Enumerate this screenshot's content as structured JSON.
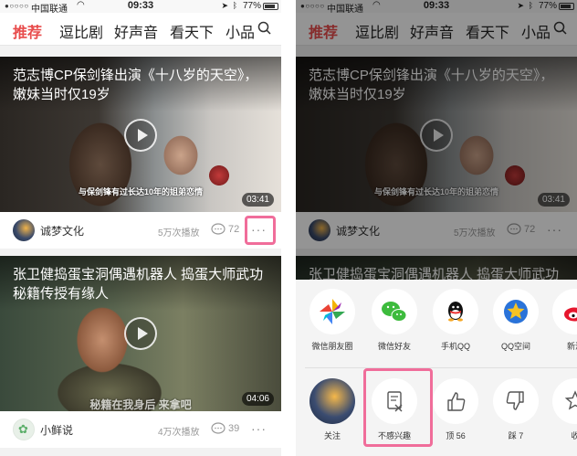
{
  "status_bar": {
    "signal": "●○○○○",
    "carrier": "中国联通",
    "wifi_icon": "wifi-icon",
    "time": "09:33",
    "battery": "77%"
  },
  "nav": {
    "tabs": [
      "推荐",
      "逗比剧",
      "好声音",
      "看天下",
      "小品"
    ],
    "active_tab": "推荐",
    "search_icon": "search-icon"
  },
  "feed": [
    {
      "title": "范志博CP保剑锋出演《十八岁的天空》，嫩妹当时仅19岁",
      "subtitle": "与保剑锋有过长达10年的姐弟恋情",
      "duration": "03:41",
      "author": "诚梦文化",
      "plays": "5万次播放",
      "comments": "72",
      "more": "···"
    },
    {
      "title": "张卫健捣蛋宝洞偶遇机器人 捣蛋大师武功秘籍传授有缘人",
      "subtitle": "秘籍在我身后  来拿吧",
      "duration": "04:06",
      "author": "小鲜说",
      "plays": "4万次播放",
      "comments": "39",
      "more": "···"
    }
  ],
  "right_feed_partial_title": "张卫健捣蛋宝洞偶遇机器人 捣蛋大师武功",
  "share_sheet": {
    "share_targets": [
      {
        "label": "微信朋友圈",
        "icon": "moments-icon"
      },
      {
        "label": "微信好友",
        "icon": "wechat-icon"
      },
      {
        "label": "手机QQ",
        "icon": "qq-icon"
      },
      {
        "label": "QQ空间",
        "icon": "qzone-icon"
      },
      {
        "label": "新浪",
        "icon": "weibo-icon"
      }
    ],
    "actions": [
      {
        "label": "关注",
        "icon": "follow-avatar"
      },
      {
        "label": "不感兴趣",
        "icon": "uninterested-icon"
      },
      {
        "label": "顶 56",
        "icon": "thumbs-up-icon"
      },
      {
        "label": "踩 7",
        "icon": "thumbs-down-icon"
      },
      {
        "label": "收",
        "icon": "favorite-icon"
      }
    ]
  },
  "colors": {
    "accent": "#e84c4c",
    "highlight": "#f06d9a"
  }
}
